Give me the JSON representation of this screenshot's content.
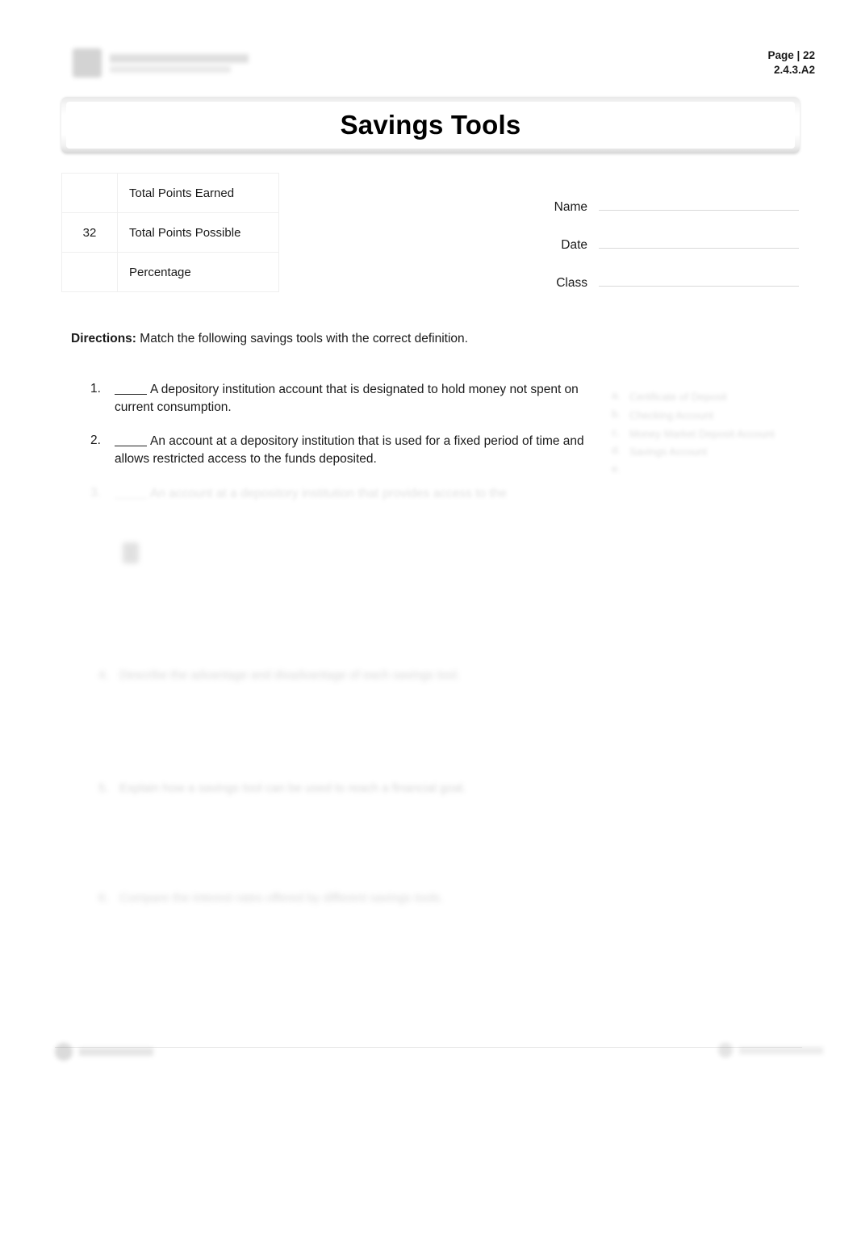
{
  "document": {
    "title": "Savings Tools",
    "page_label": "Page | 22",
    "doc_code": "2.4.3.A2"
  },
  "points_table": {
    "rows": [
      {
        "score": "",
        "label": "Total Points Earned"
      },
      {
        "score": "32",
        "label": "Total Points Possible"
      },
      {
        "score": "",
        "label": "Percentage"
      }
    ]
  },
  "student_info": {
    "fields": [
      {
        "label": "Name",
        "value": ""
      },
      {
        "label": "Date",
        "value": ""
      },
      {
        "label": "Class",
        "value": ""
      }
    ]
  },
  "directions": {
    "prefix": "Directions:",
    "text": "Match the following savings tools with the correct definition."
  },
  "matching": {
    "questions": [
      {
        "number": "1.",
        "answer": "",
        "text": "A depository institution account that is designated to hold money not spent on current consumption."
      },
      {
        "number": "2.",
        "answer": "",
        "text": "An account at a depository institution that is used for a fixed period of time and allows restricted access to the funds deposited."
      },
      {
        "number": "3.",
        "answer": "",
        "text": "An account at a depository institution that provides access to the"
      }
    ],
    "options": [
      {
        "letter": "a.",
        "label": "Certificate of Deposit"
      },
      {
        "letter": "b.",
        "label": "Checking Account"
      },
      {
        "letter": "c.",
        "label": "Money Market Deposit Account"
      },
      {
        "letter": "d.",
        "label": "Savings Account"
      },
      {
        "letter": "e.",
        "label": ""
      }
    ]
  },
  "lower_items": [
    {
      "number": "4.",
      "text": "Describe the advantage and disadvantage of each savings tool.",
      "answer": ""
    },
    {
      "number": "5.",
      "text": "Explain how a savings tool can be used to reach a financial goal.",
      "answer": ""
    },
    {
      "number": "6.",
      "text": "Compare the interest rates offered by different savings tools.",
      "answer": ""
    }
  ],
  "footer": {
    "left_text": "",
    "right_text": ""
  }
}
